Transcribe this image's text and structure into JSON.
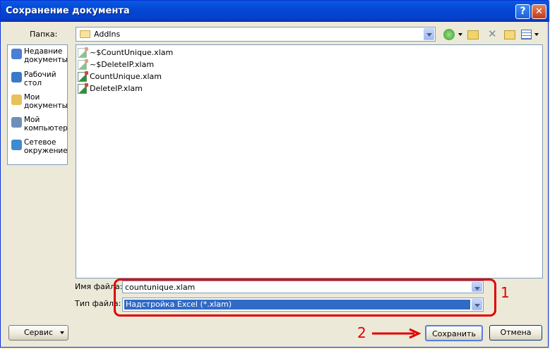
{
  "window": {
    "title": "Сохранение документа",
    "help_glyph": "?",
    "close_glyph": "✕"
  },
  "folder": {
    "label": "Папка:",
    "value": "AddIns"
  },
  "toolbar_icons": [
    "back-icon",
    "up-folder-icon",
    "delete-icon",
    "new-folder-icon",
    "views-icon"
  ],
  "places": [
    {
      "label": "Недавние документы",
      "icon": "recent-documents-icon",
      "color": "#4a7fd4"
    },
    {
      "label": "Рабочий стол",
      "icon": "desktop-icon",
      "color": "#3a78c8"
    },
    {
      "label": "Мои документы",
      "icon": "my-documents-icon",
      "color": "#e8c15a"
    },
    {
      "label": "Мой компьютер",
      "icon": "my-computer-icon",
      "color": "#6f8fb8"
    },
    {
      "label": "Сетевое окружение",
      "icon": "network-icon",
      "color": "#3f8ad0"
    }
  ],
  "files": [
    {
      "name": "~$CountUnique.xlam",
      "hidden": true
    },
    {
      "name": "~$DeleteIP.xlam",
      "hidden": true
    },
    {
      "name": "CountUnique.xlam",
      "hidden": false
    },
    {
      "name": "DeleteIP.xlam",
      "hidden": false
    }
  ],
  "filename": {
    "label": "Имя файла:",
    "value": "countunique.xlam"
  },
  "filetype": {
    "label": "Тип файла:",
    "value": "Надстройка Excel (*.xlam)"
  },
  "buttons": {
    "tools": "Сервис",
    "save": "Сохранить",
    "cancel": "Отмена"
  },
  "annotations": {
    "one": "1",
    "two": "2",
    "color": "#e00000"
  }
}
